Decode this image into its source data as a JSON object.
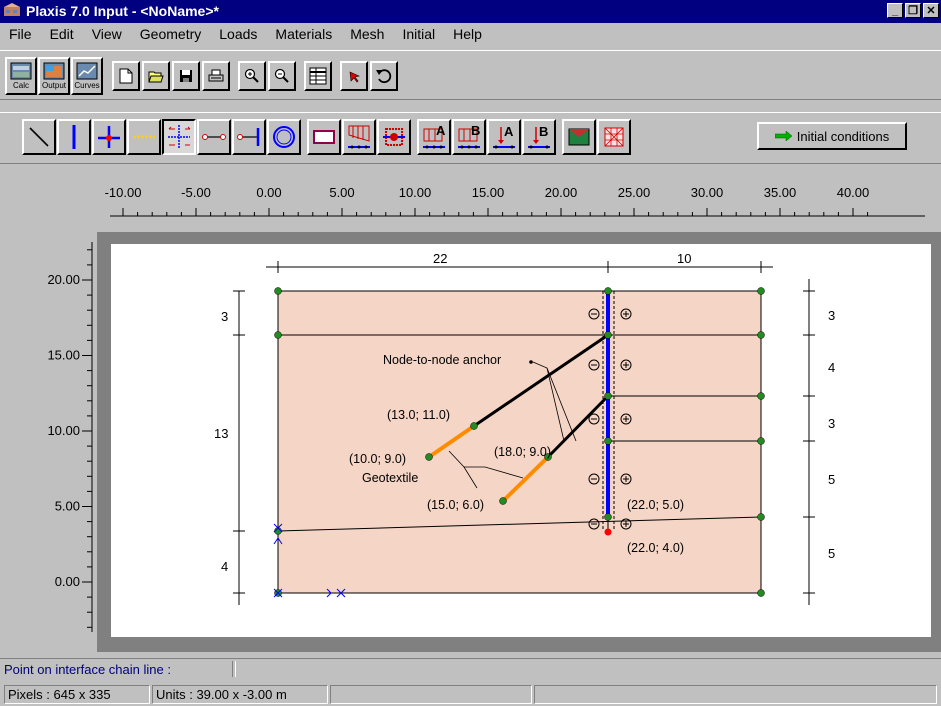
{
  "window": {
    "title": "Plaxis 7.0 Input - <NoName>*",
    "minimize": "_",
    "restore": "❐",
    "close": "✕"
  },
  "menu": [
    "File",
    "Edit",
    "View",
    "Geometry",
    "Loads",
    "Materials",
    "Mesh",
    "Initial",
    "Help"
  ],
  "toolbar1": {
    "programs": [
      {
        "label": "Calc",
        "icon": "calc-program-icon"
      },
      {
        "label": "Output",
        "icon": "output-program-icon"
      },
      {
        "label": "Curves",
        "icon": "curves-program-icon"
      }
    ],
    "tools": [
      "new-file-icon",
      "open-file-icon",
      "save-icon",
      "print-icon",
      "zoom-in-icon",
      "zoom-out-icon",
      "table-icon",
      "selection-arrow-icon",
      "undo-icon"
    ]
  },
  "toolbar2": {
    "tools": [
      "geometry-line-icon",
      "plate-icon",
      "hinge-icon",
      "geogrid-icon",
      "interface-icon",
      "node-to-node-anchor-icon",
      "fixed-end-anchor-icon",
      "tunnel-icon",
      "standard-fixities-icon",
      "distributed-load-icon",
      "rotation-fixity-icon",
      "distributed-load-a-icon",
      "distributed-load-b-icon",
      "point-load-a-icon",
      "point-load-b-icon",
      "material-sets-icon",
      "generate-mesh-icon"
    ],
    "initial_conditions": "Initial conditions",
    "initial_conditions_icon": "green-arrow-icon"
  },
  "ruler": {
    "x_labels": [
      "-10.00",
      "-5.00",
      "0.00",
      "5.00",
      "10.00",
      "15.00",
      "20.00",
      "25.00",
      "30.00",
      "35.00",
      "40.00"
    ],
    "y_labels": [
      "20.00",
      "15.00",
      "10.00",
      "5.00",
      "0.00"
    ]
  },
  "model": {
    "dims_top": [
      "22",
      "10"
    ],
    "dims_left": [
      "3",
      "13",
      "4"
    ],
    "dims_right": [
      "3",
      "4",
      "3",
      "5",
      "5"
    ],
    "annotations": {
      "anchor_label": "Node-to-node anchor",
      "geotextile_label": "Geotextile",
      "p1": "(13.0; 11.0)",
      "p2": "(10.0; 9.0)",
      "p3": "(18.0; 9.0)",
      "p4": "(15.0; 6.0)",
      "p5": "(22.0; 5.0)",
      "p6": "(22.0; 4.0)"
    },
    "colors": {
      "soil": "#f5d5c5",
      "wall": "#0000ff",
      "geotextile": "#ff8c00",
      "anchor": "#000000",
      "node": "#228b22",
      "selected_node": "#ff0000"
    }
  },
  "status": {
    "message": "Point on interface chain line :",
    "pixels": "Pixels : 645 x 335",
    "units": "Units : 39.00 x -3.00 m"
  }
}
